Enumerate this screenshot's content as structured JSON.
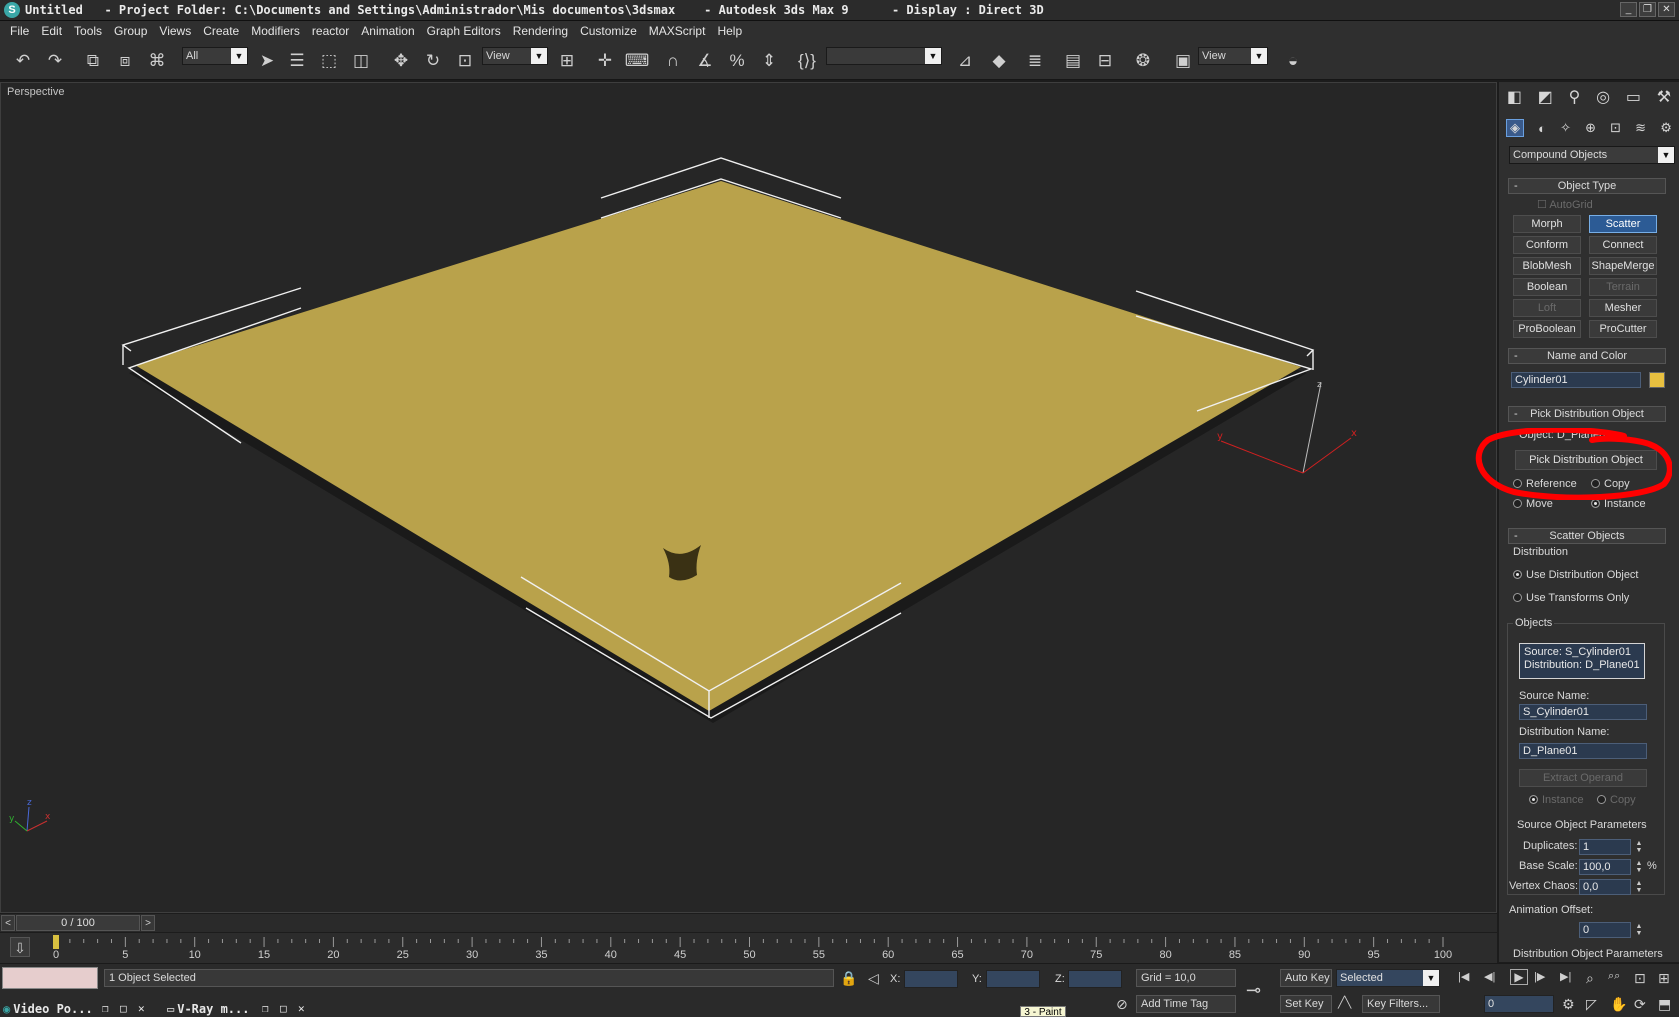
{
  "window": {
    "title": "Untitled   - Project Folder: C:\\Documents and Settings\\Administrador\\Mis documentos\\3dsmax    - Autodesk 3ds Max 9      - Display : Direct 3D",
    "minimize": "_",
    "restore": "❐",
    "close": "✕"
  },
  "menu": [
    "File",
    "Edit",
    "Tools",
    "Group",
    "Views",
    "Create",
    "Modifiers",
    "reactor",
    "Animation",
    "Graph Editors",
    "Rendering",
    "Customize",
    "MAXScript",
    "Help"
  ],
  "toolbar": {
    "selection_filter": "All",
    "reference_coord": "View",
    "named_selection": "",
    "viewport_layout": "View",
    "icons": {
      "undo": "↶",
      "redo": "↷",
      "link": "⧉",
      "unlink": "⧈",
      "bind": "⌘",
      "select": "➤",
      "select_by_name": "☰",
      "rect_region": "⬚",
      "window_crossing": "◫",
      "move": "✥",
      "rotate": "↻",
      "scale": "⊡",
      "pivot": "⊞",
      "manipulate": "✛",
      "keyboard_shortcut": "⌨",
      "snaps": "∩",
      "angle_snap": "∡",
      "percent_snap": "%",
      "spinner_snap": "⇕",
      "edit_named": "{⟩}",
      "mirror": "⊿",
      "align": "◆",
      "layers": "≣",
      "curve_editor": "▤",
      "schematic": "⊟",
      "material_editor": "❂",
      "render_scene": "▣",
      "quick_render": "◒"
    }
  },
  "viewport": {
    "label": "Perspective",
    "gizmo": {
      "x": "x",
      "y": "y",
      "z": "z"
    }
  },
  "command_panel": {
    "tabs": [
      "◧",
      "◩",
      "⚲",
      "◎",
      "▭",
      "⚒"
    ],
    "create_tabs": [
      "◈",
      "◐",
      "✧",
      "⊕",
      "⊡",
      "≋",
      "⚙"
    ],
    "category": "Compound Objects",
    "object_type": {
      "header": "Object Type",
      "autogrid": "AutoGrid",
      "buttons": [
        {
          "label": "Morph",
          "state": "normal"
        },
        {
          "label": "Scatter",
          "state": "active"
        },
        {
          "label": "Conform",
          "state": "normal"
        },
        {
          "label": "Connect",
          "state": "normal"
        },
        {
          "label": "BlobMesh",
          "state": "normal"
        },
        {
          "label": "ShapeMerge",
          "state": "normal"
        },
        {
          "label": "Boolean",
          "state": "normal"
        },
        {
          "label": "Terrain",
          "state": "disabled"
        },
        {
          "label": "Loft",
          "state": "disabled"
        },
        {
          "label": "Mesher",
          "state": "normal"
        },
        {
          "label": "ProBoolean",
          "state": "normal"
        },
        {
          "label": "ProCutter",
          "state": "normal"
        }
      ]
    },
    "name_color": {
      "header": "Name and Color",
      "name": "Cylinder01",
      "color": "#e8c040"
    },
    "pick_distribution": {
      "header": "Pick Distribution Object",
      "object": "Object: D_Plane01",
      "button": "Pick Distribution Object",
      "reference": "Reference",
      "copy": "Copy",
      "move": "Move",
      "instance": "Instance"
    },
    "scatter_objects": {
      "header": "Scatter Objects",
      "distribution_label": "Distribution",
      "use_distribution": "Use Distribution Object",
      "use_transforms": "Use Transforms Only",
      "objects_label": "Objects",
      "list": [
        "Source: S_Cylinder01",
        "Distribution: D_Plane01"
      ],
      "source_name_label": "Source Name:",
      "source_name": "S_Cylinder01",
      "distribution_name_label": "Distribution Name:",
      "distribution_name": "D_Plane01",
      "extract_operand": "Extract Operand",
      "instance": "Instance",
      "copy": "Copy"
    },
    "source_params": {
      "header": "Source Object Parameters",
      "duplicates_label": "Duplicates:",
      "duplicates": "1",
      "base_scale_label": "Base Scale:",
      "base_scale": "100,0",
      "percent": "%",
      "vertex_chaos_label": "Vertex Chaos:",
      "vertex_chaos": "0,0",
      "anim_offset_label": "Animation Offset:",
      "anim_offset": "0"
    },
    "next_rollout": "Distribution Object Parameters"
  },
  "time_slider": {
    "frame": "0 / 100",
    "prev": "<",
    "next": ">"
  },
  "trackbar": {
    "ticks": [
      "0",
      "5",
      "10",
      "15",
      "20",
      "25",
      "30",
      "35",
      "40",
      "45",
      "50",
      "55",
      "60",
      "65",
      "70",
      "75",
      "80",
      "85",
      "90",
      "95",
      "100"
    ],
    "key_icon": "⇩"
  },
  "status": {
    "selection": "1 Object Selected",
    "x_label": "X:",
    "y_label": "Y:",
    "z_label": "Z:",
    "grid": "Grid = 10,0",
    "add_time_tag": "Add Time Tag",
    "auto_key": "Auto Key",
    "set_key": "Set Key",
    "key_filters": "Key Filters...",
    "key_mode": "Selected",
    "current_frame": "0",
    "tooltip": "3 - Paint",
    "icons": {
      "lock": "🔒",
      "abs_mode": "◁",
      "time_tag": "⊘",
      "key": "⊸",
      "key_filter": "╱╲",
      "go_start": "|◀",
      "prev_frame": "◀|",
      "play": "▶",
      "next_frame": "|▶",
      "go_end": "▶|",
      "time_config": "⚙",
      "zoom": "⌕",
      "zoom_all": "⌕⌕",
      "zoom_ext": "⊡",
      "zoom_ext_all": "⊞",
      "fov": "◸",
      "pan": "✋",
      "orbit": "⟳",
      "maximize": "⬒"
    }
  },
  "taskbar": [
    {
      "label": "Video Po...",
      "icon": "◉"
    },
    {
      "label": "V-Ray m...",
      "icon": "▭"
    }
  ],
  "taskbar_buttons": {
    "restore": "❐",
    "maximize": "□",
    "close": "✕"
  }
}
